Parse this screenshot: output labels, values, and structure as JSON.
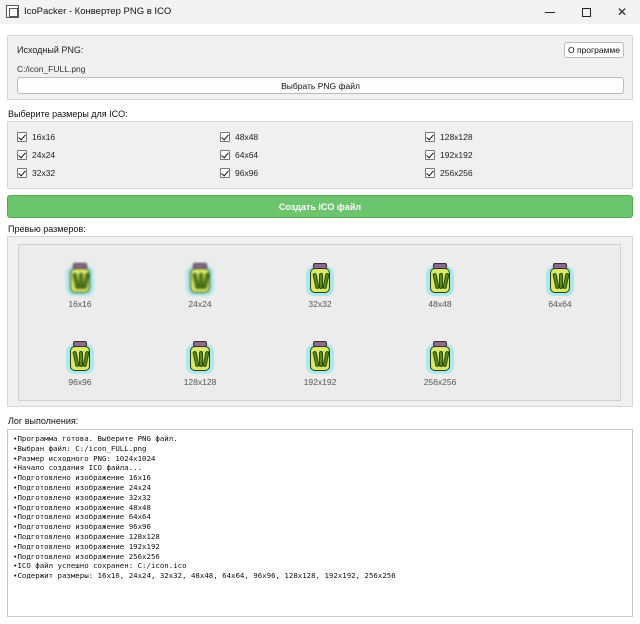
{
  "window": {
    "title": "IcoPacker - Конвертер PNG в ICO",
    "minimize_icon": "minimize-icon",
    "maximize_icon": "maximize-icon",
    "close_icon": "close-icon"
  },
  "source": {
    "label": "Исходный PNG:",
    "path": "C:/icon_FULL.png",
    "about_button": "О программе",
    "pick_button": "Выбрать PNG файл"
  },
  "sizes": {
    "title": "Выберите размеры для ICO:",
    "options": [
      {
        "label": "16x16",
        "checked": true
      },
      {
        "label": "48x48",
        "checked": true
      },
      {
        "label": "128x128",
        "checked": true
      },
      {
        "label": "24x24",
        "checked": true
      },
      {
        "label": "64x64",
        "checked": true
      },
      {
        "label": "192x192",
        "checked": true
      },
      {
        "label": "32x32",
        "checked": true
      },
      {
        "label": "96x96",
        "checked": true
      },
      {
        "label": "256x256",
        "checked": true
      }
    ]
  },
  "create_button": "Создать ICO файл",
  "accent_color": "#6cc46c",
  "preview": {
    "title": "Превью размеров:",
    "items": [
      "16x16",
      "24x24",
      "32x32",
      "48x48",
      "64x64",
      "96x96",
      "128x128",
      "192x192",
      "256x256"
    ]
  },
  "log": {
    "title": "Лог выполнения:",
    "lines": [
      "Программа готова. Выберите PNG файл.",
      "Выбран файл: C:/icon_FULL.png",
      "Размер исходного PNG: 1024x1024",
      "Начало создания ICO файла...",
      "Подготовлено изображение 16x16",
      "Подготовлено изображение 24x24",
      "Подготовлено изображение 32x32",
      "Подготовлено изображение 48x48",
      "Подготовлено изображение 64x64",
      "Подготовлено изображение 96x96",
      "Подготовлено изображение 128x128",
      "Подготовлено изображение 192x192",
      "Подготовлено изображение 256x256",
      "ICO файл успешно сохранен: C:/icon.ico",
      "Содержит размеры: 16x16, 24x24, 32x32, 48x48, 64x64, 96x96, 128x128, 192x192, 256x256"
    ]
  }
}
